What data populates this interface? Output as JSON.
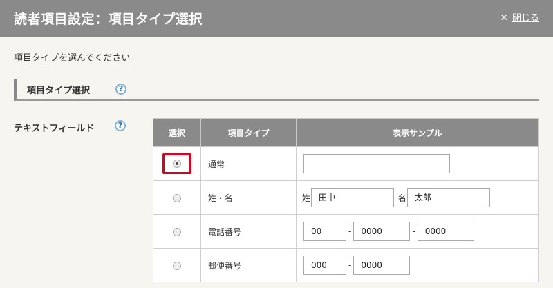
{
  "header": {
    "title": "読者項目設定：項目タイプ選択",
    "close_label": "閉じる"
  },
  "instruction": "項目タイプを選んでください。",
  "section": {
    "title": "項目タイプ選択",
    "help": "?"
  },
  "field": {
    "label": "テキストフィールド",
    "help": "?"
  },
  "table": {
    "columns": [
      "選択",
      "項目タイプ",
      "表示サンプル"
    ],
    "rows": [
      {
        "type": "通常",
        "selected": true
      },
      {
        "type": "姓・名",
        "selected": false,
        "prefix1": "姓",
        "value1": "田中",
        "prefix2": "名",
        "value2": "太郎"
      },
      {
        "type": "電話番号",
        "selected": false,
        "value1": "00",
        "sep1": "-",
        "value2": "0000",
        "sep2": "-",
        "value3": "0000"
      },
      {
        "type": "郵便番号",
        "selected": false,
        "value1": "000",
        "sep1": "-",
        "value2": "0000"
      }
    ]
  },
  "colors": {
    "titlebar": "#8a8a8a",
    "highlight": "#e0001b",
    "help_icon": "#1f6fb2"
  }
}
